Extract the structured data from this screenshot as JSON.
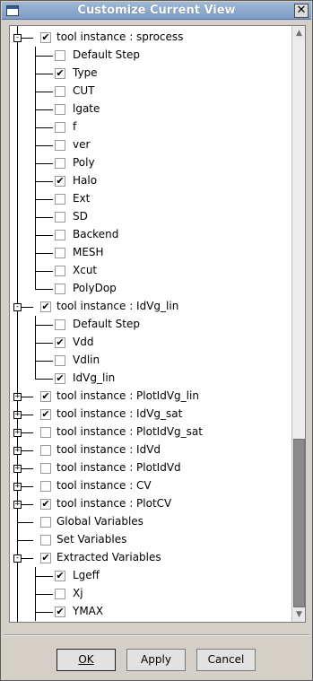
{
  "window": {
    "title": "Customize Current View"
  },
  "tree": [
    {
      "level": 1,
      "label": "tool instance : sprocess",
      "checked": true,
      "expander": "-"
    },
    {
      "level": 2,
      "label": "Default Step",
      "checked": false
    },
    {
      "level": 2,
      "label": "Type",
      "checked": true
    },
    {
      "level": 2,
      "label": "CUT",
      "checked": false
    },
    {
      "level": 2,
      "label": "lgate",
      "checked": false
    },
    {
      "level": 2,
      "label": "f",
      "checked": false
    },
    {
      "level": 2,
      "label": "ver",
      "checked": false
    },
    {
      "level": 2,
      "label": "Poly",
      "checked": false
    },
    {
      "level": 2,
      "label": "Halo",
      "checked": true
    },
    {
      "level": 2,
      "label": "Ext",
      "checked": false
    },
    {
      "level": 2,
      "label": "SD",
      "checked": false
    },
    {
      "level": 2,
      "label": "Backend",
      "checked": false
    },
    {
      "level": 2,
      "label": "MESH",
      "checked": false
    },
    {
      "level": 2,
      "label": "Xcut",
      "checked": false
    },
    {
      "level": 2,
      "label": "PolyDop",
      "checked": false
    },
    {
      "level": 1,
      "label": "tool instance : IdVg_lin",
      "checked": true,
      "expander": "-"
    },
    {
      "level": 2,
      "label": "Default Step",
      "checked": false
    },
    {
      "level": 2,
      "label": "Vdd",
      "checked": true
    },
    {
      "level": 2,
      "label": "Vdlin",
      "checked": false
    },
    {
      "level": 2,
      "label": "IdVg_lin",
      "checked": true
    },
    {
      "level": 1,
      "label": "tool instance : PlotIdVg_lin",
      "checked": true,
      "expander": "+"
    },
    {
      "level": 1,
      "label": "tool instance : IdVg_sat",
      "checked": true,
      "expander": "+"
    },
    {
      "level": 1,
      "label": "tool instance : PlotIdVg_sat",
      "checked": false,
      "expander": "+"
    },
    {
      "level": 1,
      "label": "tool instance : IdVd",
      "checked": false,
      "expander": "+"
    },
    {
      "level": 1,
      "label": "tool instance : PlotIdVd",
      "checked": false,
      "expander": "+"
    },
    {
      "level": 1,
      "label": "tool instance : CV",
      "checked": false,
      "expander": "+"
    },
    {
      "level": 1,
      "label": "tool instance : PlotCV",
      "checked": true,
      "expander": "+"
    },
    {
      "level": 1,
      "label": "Global Variables",
      "checked": false
    },
    {
      "level": 1,
      "label": "Set Variables",
      "checked": false
    },
    {
      "level": 1,
      "label": "Extracted Variables",
      "checked": true,
      "expander": "-"
    },
    {
      "level": 2,
      "label": "Lgeff",
      "checked": true
    },
    {
      "level": 2,
      "label": "Xj",
      "checked": false
    },
    {
      "level": 2,
      "label": "YMAX",
      "checked": true
    }
  ],
  "buttons": {
    "ok": "OK",
    "apply": "Apply",
    "cancel": "Cancel"
  },
  "icons": {
    "window": "window-icon",
    "close": "close-icon",
    "scroll_up": "arrow-up-icon",
    "scroll_down": "arrow-down-icon"
  },
  "colors": {
    "titlebar": "#8aa6cc",
    "scroll_thumb": "#8a8a8a"
  }
}
